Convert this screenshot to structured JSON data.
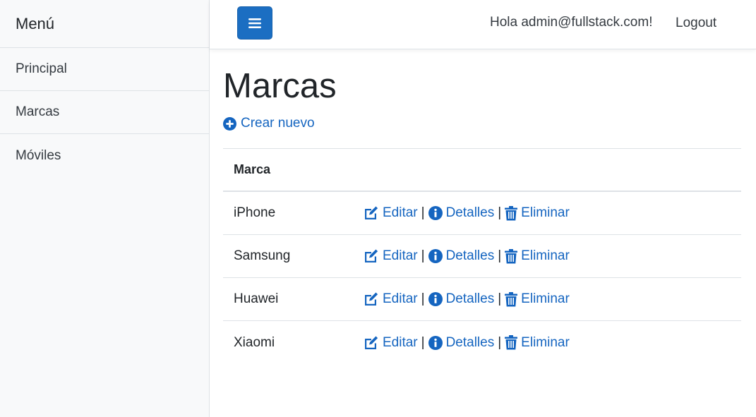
{
  "sidebar": {
    "heading": "Menú",
    "items": [
      {
        "label": "Principal"
      },
      {
        "label": "Marcas"
      },
      {
        "label": "Móviles"
      }
    ]
  },
  "topbar": {
    "toggle_icon": "hamburger-icon",
    "greeting": "Hola admin@fullstack.com!",
    "logout": "Logout"
  },
  "main": {
    "title": "Marcas",
    "create_label": "Crear nuevo",
    "table": {
      "column_header": "Marca",
      "rows": [
        {
          "name": "iPhone"
        },
        {
          "name": "Samsung"
        },
        {
          "name": "Huawei"
        },
        {
          "name": "Xiaomi"
        }
      ],
      "actions": {
        "edit": "Editar",
        "details": "Detalles",
        "delete": "Eliminar",
        "separator": "|"
      }
    }
  },
  "colors": {
    "accent": "#1b6ec2",
    "link": "#1565c0",
    "sidebar_bg": "#f8f9fa",
    "border": "#dee2e6"
  }
}
